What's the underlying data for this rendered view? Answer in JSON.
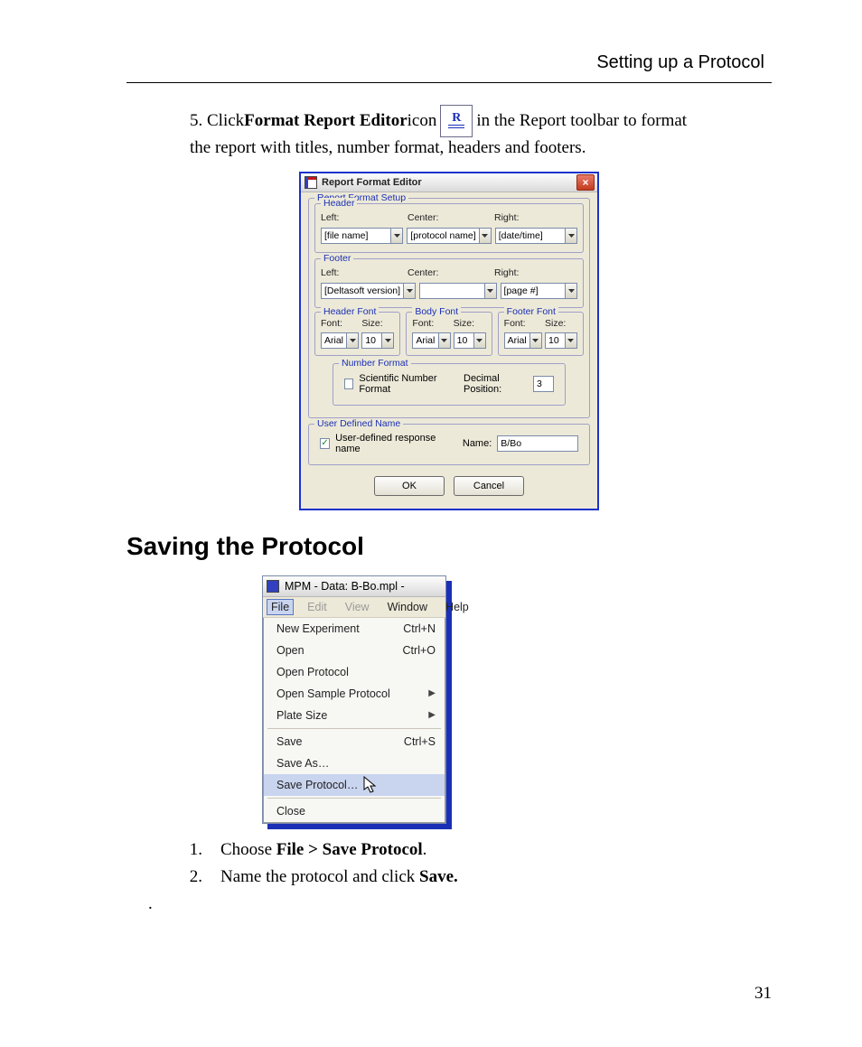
{
  "page": {
    "running_head": "Setting up a Protocol",
    "number": "31"
  },
  "intro": {
    "prefix": "5. Click ",
    "bold": "Format Report Editor",
    "mid": " icon ",
    "suffix1": " in the Report toolbar to format",
    "line2": "the report with titles, number format, headers and footers."
  },
  "dialog": {
    "title": "Report Format Editor",
    "setup_legend": "Report Format Setup",
    "header_legend": "Header",
    "footer_legend": "Footer",
    "labels": {
      "left": "Left:",
      "center": "Center:",
      "right": "Right:",
      "font": "Font:",
      "size": "Size:"
    },
    "header": {
      "left": "[file name]",
      "center": "[protocol name]",
      "right": "[date/time]"
    },
    "footer": {
      "left": "[Deltasoft version]",
      "center": "",
      "right": "[page #]"
    },
    "fonts": {
      "header_legend": "Header Font",
      "body_legend": "Body Font",
      "footer_legend": "Footer Font",
      "font_name": "Arial",
      "font_size": "10"
    },
    "number": {
      "legend": "Number Format",
      "checkbox_label": "Scientific Number Format",
      "decimal_label": "Decimal Position:",
      "decimal_value": "3"
    },
    "user": {
      "legend": "User Defined Name",
      "checkbox_label": "User-defined response name",
      "name_label": "Name:",
      "name_value": "B/Bo"
    },
    "buttons": {
      "ok": "OK",
      "cancel": "Cancel"
    }
  },
  "heading2": "Saving the Protocol",
  "menu": {
    "title": "MPM - Data: B-Bo.mpl -",
    "bar": {
      "file": "File",
      "edit": "Edit",
      "view": "View",
      "window": "Window",
      "help": "Help"
    },
    "items": {
      "new_exp": "New Experiment",
      "new_exp_accel": "Ctrl+N",
      "open": "Open",
      "open_accel": "Ctrl+O",
      "open_protocol": "Open Protocol",
      "open_sample": "Open Sample Protocol",
      "plate_size": "Plate Size",
      "save": "Save",
      "save_accel": "Ctrl+S",
      "save_as": "Save As…",
      "save_protocol": "Save Protocol…",
      "close": "Close"
    }
  },
  "steps": {
    "s1_num": "1.",
    "s1a": "Choose ",
    "s1b": "File > Save Protocol",
    "s1c": ".",
    "s2_num": "2.",
    "s2a": "Name the protocol and click ",
    "s2b": "Save.",
    "dot": "."
  }
}
